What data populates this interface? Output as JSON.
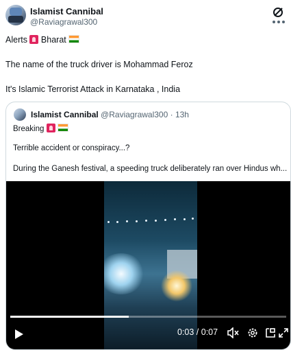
{
  "post": {
    "author_name": "Islamist Cannibal",
    "author_handle": "@Raviagrawal300",
    "line1_a": "Alerts",
    "line1_b": "Bharat",
    "line2": "The name of the truck driver is Mohammad Feroz",
    "line3": "It's Islamic Terrorist Attack in Karnataka , India"
  },
  "quoted": {
    "author_name": "Islamist Cannibal",
    "author_handle": "@Raviagrawal300",
    "time": "· 13h",
    "line1": "Breaking",
    "line2": "Terrible accident or conspiracy...?",
    "line3": "During the Ganesh festival, a speeding truck deliberately ran over Hindus wh..."
  },
  "video": {
    "current_time": "0:03",
    "duration": "0:07",
    "time_display": "0:03 / 0:07",
    "progress": 0.43
  },
  "icons": {
    "grok": "grok-icon",
    "more": "more-options-icon",
    "siren": "police-light-emoji",
    "flag": "india-flag-emoji",
    "play": "play-icon",
    "mute": "mute-icon",
    "settings": "gear-icon",
    "pip": "picture-in-picture-icon",
    "fullscreen": "fullscreen-icon"
  }
}
